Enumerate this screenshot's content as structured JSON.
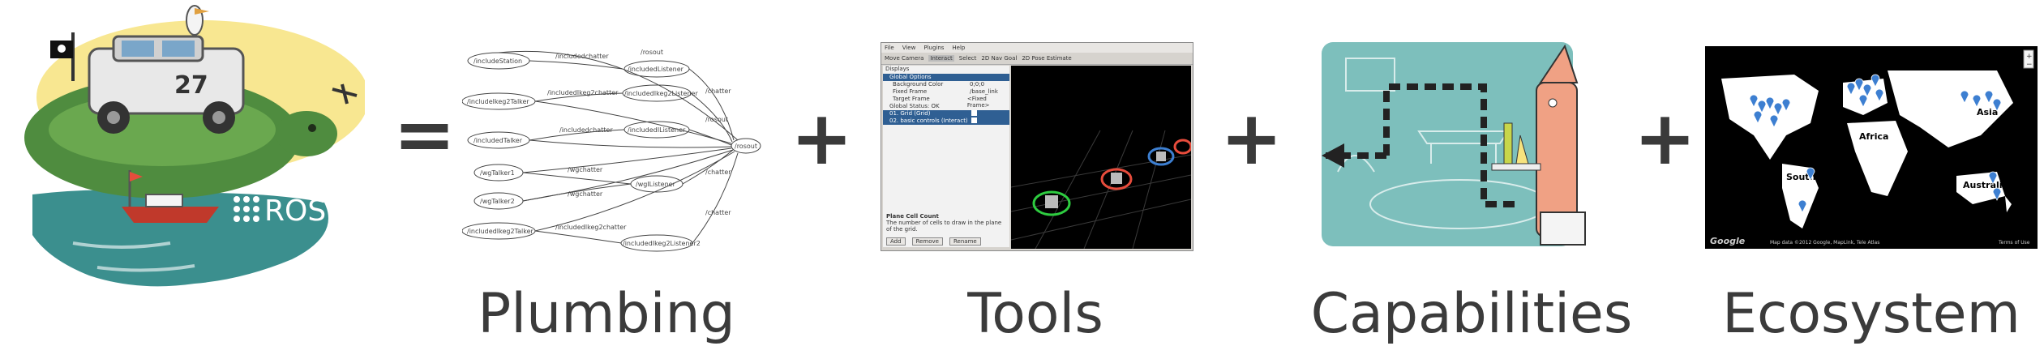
{
  "equation": {
    "equals": "=",
    "plus": "+"
  },
  "logo": {
    "brand": "ROS",
    "hood_number": "27"
  },
  "captions": {
    "plumbing": "Plumbing",
    "tools": "Tools",
    "capabilities": "Capabilities",
    "ecosystem": "Ecosystem"
  },
  "graph": {
    "nodes": [
      "/includeStation",
      "/includeIkeg2Talker",
      "/includedTalker",
      "/wgTalker1",
      "/wgTalker2",
      "/includedIkeg2Talker",
      "/rosout",
      "/includedListener",
      "/includedIkeg2Listener",
      "/includedIListener",
      "/wgIListener",
      "/includedIkeg2Listener2"
    ],
    "edges": [
      "/chatter",
      "/rosout",
      "/includedchatter",
      "/wgchatter",
      "/includedIkeg2chatter"
    ]
  },
  "rviz": {
    "menu": [
      "File",
      "View",
      "Plugins",
      "Help"
    ],
    "toolbar": [
      "Move Camera",
      "Interact",
      "Select",
      "2D Nav Goal",
      "2D Pose Estimate"
    ],
    "panel_title": "Displays",
    "props": [
      {
        "name": "Global Options",
        "value": ""
      },
      {
        "name": "Background Color",
        "value": "0;0;0"
      },
      {
        "name": "Fixed Frame",
        "value": "/base_link"
      },
      {
        "name": "Target Frame",
        "value": "<Fixed Frame>"
      },
      {
        "name": "Global Status: OK",
        "value": ""
      },
      {
        "name": "01. Grid (Grid)",
        "value": ""
      },
      {
        "name": "02. basic controls (Interact)",
        "value": ""
      }
    ],
    "desc_title": "Plane Cell Count",
    "desc_body": "The number of cells to draw in the plane of the grid.",
    "buttons": [
      "Add",
      "Remove",
      "Rename"
    ]
  },
  "map": {
    "labels": [
      "Asia",
      "Africa",
      "South America",
      "Australia"
    ],
    "logo": "Google",
    "attribution": "Map data ©2012 Google, MapLink, Tele Atlas",
    "terms": "Terms of Use"
  },
  "colors": {
    "turtle_green": "#4f8c3f",
    "water": "#3b8f8e",
    "capabilities_bg": "#7dbfbc",
    "robot_coral": "#f0a184",
    "marker_blue": "#3d7fd1"
  }
}
